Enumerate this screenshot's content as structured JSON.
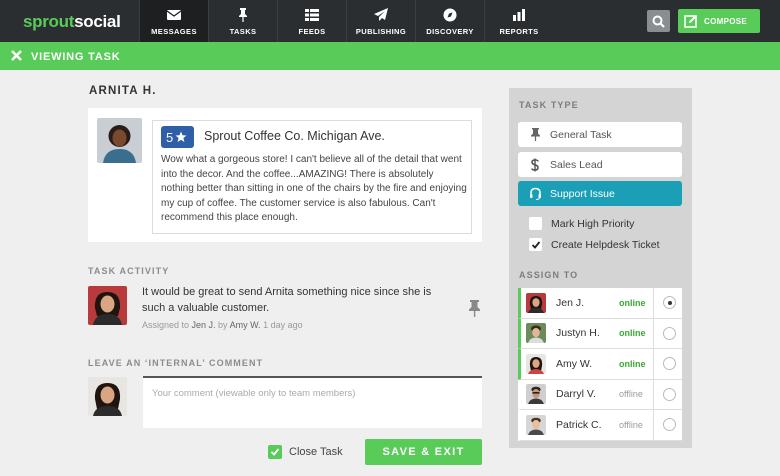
{
  "nav": {
    "logo_a": "sprout",
    "logo_b": "social",
    "items": [
      {
        "label": "MESSAGES",
        "icon": "envelope-icon"
      },
      {
        "label": "TASKS",
        "icon": "pin-icon"
      },
      {
        "label": "FEEDS",
        "icon": "feeds-icon"
      },
      {
        "label": "PUBLISHING",
        "icon": "paper-plane-icon"
      },
      {
        "label": "DISCOVERY",
        "icon": "compass-icon"
      },
      {
        "label": "REPORTS",
        "icon": "bar-chart-icon"
      }
    ],
    "active_index": 0,
    "compose_label": "COMPOSE"
  },
  "banner": {
    "title": "VIEWING TASK"
  },
  "message": {
    "author": "ARNITA H.",
    "rating": "5",
    "title": "Sprout Coffee Co. Michigan Ave.",
    "body": "Wow what a gorgeous store! I can't believe all of the detail that went into the decor. And the coffee...AMAZING! There is absolutely nothing better than sitting in one of the chairs by the fire and enjoying my cup of coffee. The customer service is also fabulous. Can't recommend this place enough."
  },
  "activity": {
    "label": "TASK ACTIVITY",
    "text": "It would be great to send Arnita something nice since she is such a valuable customer.",
    "meta_prefix": "Assigned to ",
    "assignee": "Jen J.",
    "meta_by": " by ",
    "assigner": "Amy W.",
    "meta_time": " 1 day ago"
  },
  "comment": {
    "label": "LEAVE AN ‘INTERNAL’ COMMENT",
    "placeholder": "Your comment (viewable only to team members)"
  },
  "footer": {
    "close_task_label": "Close Task",
    "close_task_checked": true,
    "save_label": "SAVE & EXIT"
  },
  "task_type": {
    "label": "TASK TYPE",
    "options": [
      {
        "label": "General Task",
        "icon": "pin-icon"
      },
      {
        "label": "Sales Lead",
        "icon": "dollar-icon"
      },
      {
        "label": "Support Issue",
        "icon": "headset-icon"
      }
    ],
    "selected_index": 2,
    "checks": [
      {
        "label": "Mark High Priority",
        "checked": false
      },
      {
        "label": "Create Helpdesk Ticket",
        "checked": true
      }
    ]
  },
  "assign": {
    "label": "ASSIGN TO",
    "users": [
      {
        "name": "Jen J.",
        "status": "online",
        "selected": true
      },
      {
        "name": "Justyn H.",
        "status": "online",
        "selected": false
      },
      {
        "name": "Amy W.",
        "status": "online",
        "selected": false
      },
      {
        "name": "Darryl V.",
        "status": "offline",
        "selected": false
      },
      {
        "name": "Patrick C.",
        "status": "offline",
        "selected": false
      }
    ]
  },
  "colors": {
    "brand_green": "#59cb59",
    "nav_dark": "#2b2e30",
    "support_blue": "#1a9fb7",
    "rating_blue": "#2f5fa7"
  }
}
